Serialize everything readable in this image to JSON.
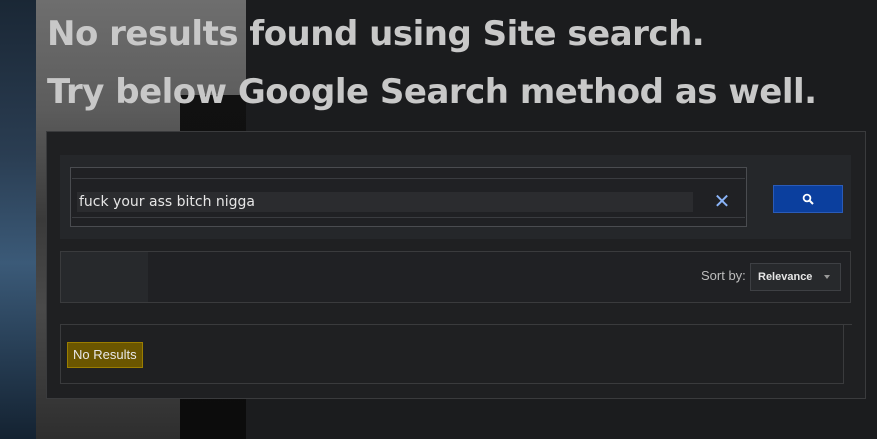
{
  "headline": {
    "line1": "No results found using Site search.",
    "line2": "Try below Google Search method as well."
  },
  "search": {
    "query": "fuck your ass bitch nigga",
    "clear_icon": "close-icon",
    "submit_icon": "search-icon",
    "accent_color": "#0b3f9e"
  },
  "sort": {
    "label": "Sort by:",
    "selected": "Relevance"
  },
  "results": {
    "status": "No Results",
    "status_color": "#6b5600"
  }
}
